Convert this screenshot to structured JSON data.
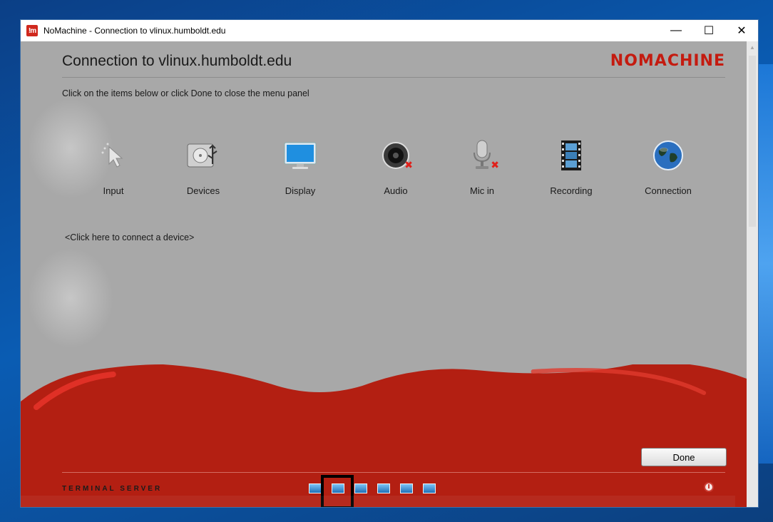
{
  "window": {
    "app_icon_text": "!m",
    "title": "NoMachine - Connection to vlinux.humboldt.edu",
    "controls": {
      "minimize": "—",
      "maximize": "☐",
      "close": "✕"
    }
  },
  "header": {
    "title": "Connection to vlinux.humboldt.edu",
    "brand": "NOMACHINE"
  },
  "subtitle": "Click on the items below or click Done to close the menu panel",
  "menu_items": [
    {
      "label": "Input",
      "icon": "cursor-icon"
    },
    {
      "label": "Devices",
      "icon": "devices-icon"
    },
    {
      "label": "Display",
      "icon": "monitor-icon"
    },
    {
      "label": "Audio",
      "icon": "speaker-muted-icon"
    },
    {
      "label": "Mic in",
      "icon": "microphone-muted-icon"
    },
    {
      "label": "Recording",
      "icon": "film-icon"
    },
    {
      "label": "Connection",
      "icon": "globe-icon"
    }
  ],
  "connect_link": "<Click here to connect a device>",
  "done_label": "Done",
  "footer": {
    "label": "TERMINAL SERVER",
    "toolbar": [
      {
        "name": "fit-to-window-icon",
        "selected": false
      },
      {
        "name": "resize-remote-display-icon",
        "selected": true
      },
      {
        "name": "fullscreen-icon",
        "selected": false
      },
      {
        "name": "multiple-monitors-icon",
        "selected": false
      },
      {
        "name": "scale-icon",
        "selected": false
      },
      {
        "name": "display-settings-icon",
        "selected": false
      }
    ]
  },
  "colors": {
    "brand_red": "#c41b10",
    "panel_gray": "#a8a8a8",
    "wave_red": "#b71c10"
  }
}
